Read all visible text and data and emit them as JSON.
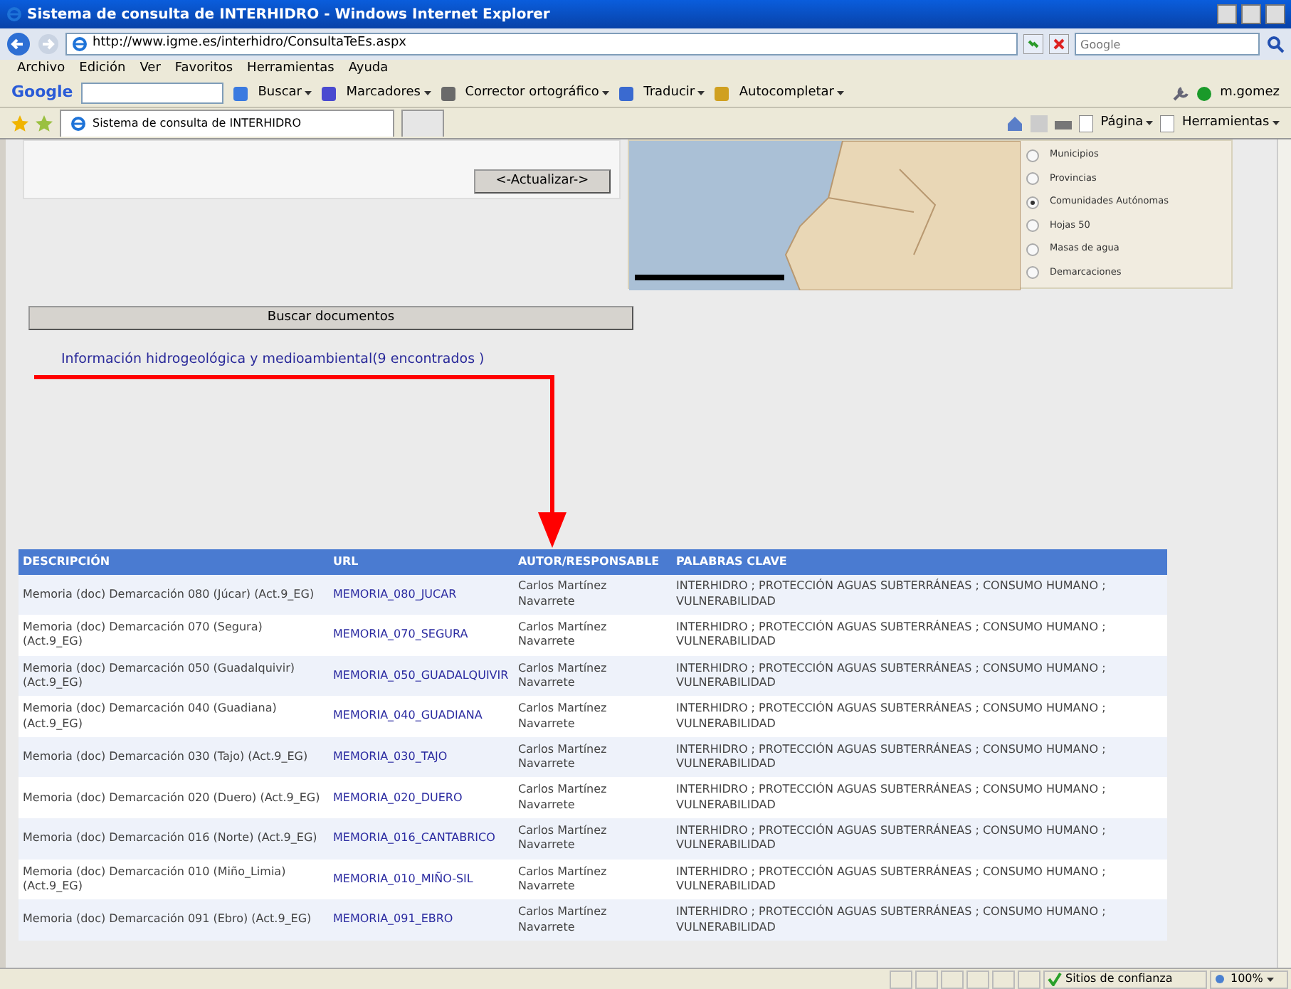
{
  "window": {
    "title": "Sistema de consulta de INTERHIDRO - Windows Internet Explorer"
  },
  "address_bar": {
    "url": "http://www.igme.es/interhidro/ConsultaTeEs.aspx"
  },
  "search_field": {
    "placeholder": "Google"
  },
  "menu": [
    "Archivo",
    "Edición",
    "Ver",
    "Favoritos",
    "Herramientas",
    "Ayuda"
  ],
  "google_toolbar": {
    "logo": "Google",
    "items": [
      "Buscar",
      "Marcadores",
      "Corrector ortográfico",
      "Traducir",
      "Autocompletar"
    ],
    "user": "m.gomez"
  },
  "tab": {
    "title": "Sistema de consulta de INTERHIDRO"
  },
  "command_bar": [
    "Página",
    "Herramientas"
  ],
  "page": {
    "update_button": "<-Actualizar->",
    "map": {
      "layers": [
        {
          "label": "Municipios",
          "selected": false
        },
        {
          "label": "Provincias",
          "selected": false
        },
        {
          "label": "Comunidades Autónomas",
          "selected": true
        },
        {
          "label": "Hojas 50",
          "selected": false
        },
        {
          "label": "Masas de agua",
          "selected": false
        },
        {
          "label": "Demarcaciones",
          "selected": false
        }
      ]
    },
    "search_button": "Buscar documentos",
    "results_link": "Información hidrogeológica y medioambiental(9 encontrados )",
    "table": {
      "columns": [
        "DESCRIPCIÓN",
        "URL",
        "AUTOR/RESPONSABLE",
        "PALABRAS CLAVE"
      ],
      "rows": [
        [
          "Memoria (doc) Demarcación 080 (Júcar) (Act.9_EG)",
          "MEMORIA_080_JUCAR",
          "Carlos Martínez Navarrete",
          "INTERHIDRO ; PROTECCIÓN AGUAS SUBTERRÁNEAS ; CONSUMO HUMANO ; VULNERABILIDAD"
        ],
        [
          "Memoria (doc) Demarcación 070 (Segura) (Act.9_EG)",
          "MEMORIA_070_SEGURA",
          "Carlos Martínez Navarrete",
          "INTERHIDRO ; PROTECCIÓN AGUAS SUBTERRÁNEAS ; CONSUMO HUMANO ; VULNERABILIDAD"
        ],
        [
          "Memoria (doc) Demarcación 050 (Guadalquivir) (Act.9_EG)",
          "MEMORIA_050_GUADALQUIVIR",
          "Carlos Martínez Navarrete",
          "INTERHIDRO ; PROTECCIÓN AGUAS SUBTERRÁNEAS ; CONSUMO HUMANO ; VULNERABILIDAD"
        ],
        [
          "Memoria (doc) Demarcación 040 (Guadiana) (Act.9_EG)",
          "MEMORIA_040_GUADIANA",
          "Carlos Martínez Navarrete",
          "INTERHIDRO ; PROTECCIÓN AGUAS SUBTERRÁNEAS ; CONSUMO HUMANO ; VULNERABILIDAD"
        ],
        [
          "Memoria (doc) Demarcación 030 (Tajo) (Act.9_EG)",
          "MEMORIA_030_TAJO",
          "Carlos Martínez Navarrete",
          "INTERHIDRO ; PROTECCIÓN AGUAS SUBTERRÁNEAS ; CONSUMO HUMANO ; VULNERABILIDAD"
        ],
        [
          "Memoria (doc) Demarcación 020 (Duero) (Act.9_EG)",
          "MEMORIA_020_DUERO",
          "Carlos Martínez Navarrete",
          "INTERHIDRO ; PROTECCIÓN AGUAS SUBTERRÁNEAS ; CONSUMO HUMANO ; VULNERABILIDAD"
        ],
        [
          "Memoria (doc) Demarcación 016 (Norte) (Act.9_EG)",
          "MEMORIA_016_CANTABRICO",
          "Carlos Martínez Navarrete",
          "INTERHIDRO ; PROTECCIÓN AGUAS SUBTERRÁNEAS ; CONSUMO HUMANO ; VULNERABILIDAD"
        ],
        [
          "Memoria (doc) Demarcación 010 (Miño_Limia) (Act.9_EG)",
          "MEMORIA_010_MIÑO-SIL",
          "Carlos Martínez Navarrete",
          "INTERHIDRO ; PROTECCIÓN AGUAS SUBTERRÁNEAS ; CONSUMO HUMANO ; VULNERABILIDAD"
        ],
        [
          "Memoria (doc) Demarcación 091 (Ebro) (Act.9_EG)",
          "MEMORIA_091_EBRO",
          "Carlos Martínez Navarrete",
          "INTERHIDRO ; PROTECCIÓN AGUAS SUBTERRÁNEAS ; CONSUMO HUMANO ; VULNERABILIDAD"
        ]
      ]
    }
  },
  "status_bar": {
    "zone": "Sitios de confianza",
    "zoom": "100%"
  }
}
